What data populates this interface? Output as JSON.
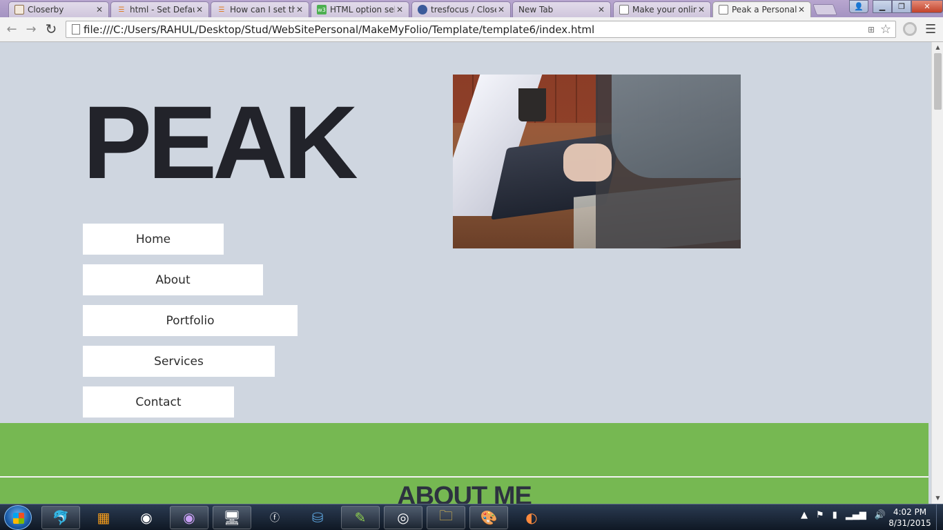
{
  "browser": {
    "tabs": [
      {
        "label": "Closerby",
        "icon": "image-icon"
      },
      {
        "label": "html - Set Defaul",
        "icon": "stackoverflow-icon"
      },
      {
        "label": "How can I set the",
        "icon": "stackoverflow-icon"
      },
      {
        "label": "HTML option sele",
        "icon": "w3schools-icon"
      },
      {
        "label": "tresfocus / Close",
        "icon": "github-icon"
      },
      {
        "label": "New Tab",
        "icon": ""
      },
      {
        "label": "Make your online",
        "icon": "page-icon"
      },
      {
        "label": "Peak a Personal F",
        "icon": "page-icon",
        "active": true
      }
    ],
    "close_glyph": "✕",
    "url": "file:///C:/Users/RAHUL/Desktop/Stud/WebSitePersonal/MakeMyFolio/Template/template6/index.html"
  },
  "page": {
    "logo": "PEAK",
    "nav": [
      {
        "label": "Home"
      },
      {
        "label": "About"
      },
      {
        "label": "Portfolio"
      },
      {
        "label": "Services"
      },
      {
        "label": "Contact"
      }
    ],
    "section_title": "ABOUT ME",
    "colors": {
      "background": "#cfd6e0",
      "accent_green": "#76b852",
      "text_dark": "#22232a"
    }
  },
  "taskbar": {
    "clock_time": "4:02 PM",
    "clock_date": "8/31/2015",
    "apps": [
      "dolphin-app-icon",
      "office-app-icon",
      "eclipse-app-icon",
      "eclipse-purple-app-icon",
      "remote-desktop-app-icon",
      "flashbuilder-app-icon",
      "mysql-app-icon",
      "notepadpp-app-icon",
      "chrome-app-icon",
      "explorer-app-icon",
      "paint-app-icon",
      "firefox-app-icon"
    ]
  }
}
